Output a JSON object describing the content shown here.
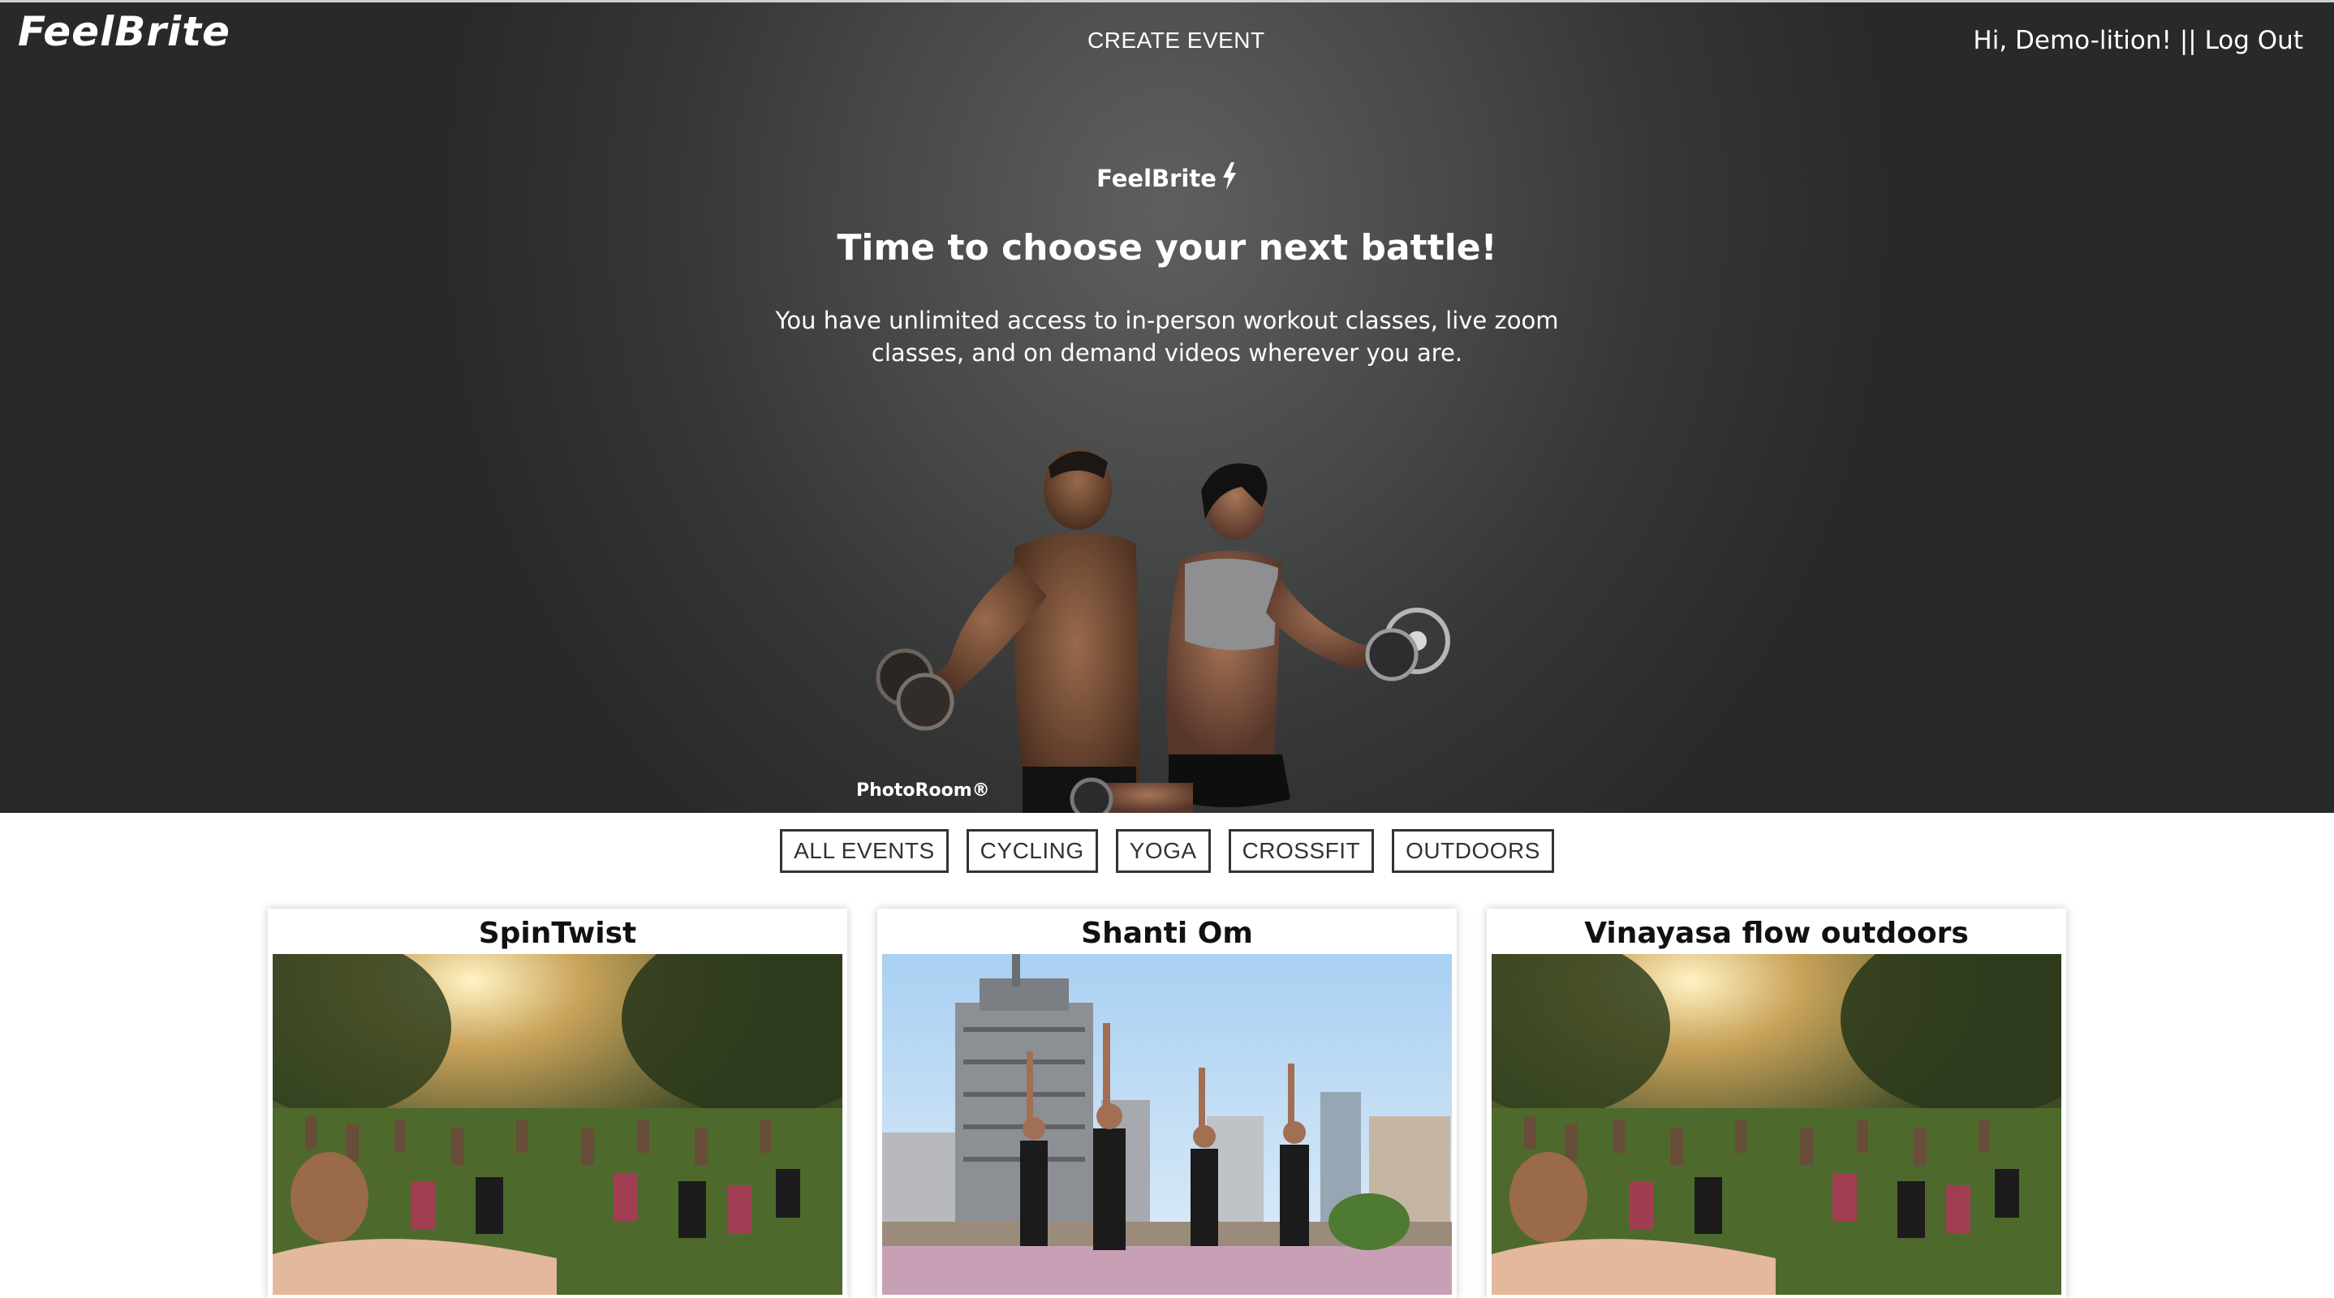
{
  "header": {
    "logo": "FeelBrite",
    "create_event": "CREATE EVENT",
    "greeting": "Hi, Demo-lition!",
    "separator": "||",
    "logout": "Log Out"
  },
  "hero": {
    "brand": "FeelBrite",
    "headline": "Time to choose your next battle!",
    "subtext": "You have unlimited access to in-person workout classes, live zoom classes, and on demand videos wherever you are.",
    "watermark": "PhotoRoom®"
  },
  "filters": [
    "ALL EVENTS",
    "CYCLING",
    "YOGA",
    "CROSSFIT",
    "OUTDOORS"
  ],
  "events": [
    {
      "title": "SpinTwist"
    },
    {
      "title": "Shanti Om"
    },
    {
      "title": "Vinayasa flow outdoors"
    }
  ]
}
